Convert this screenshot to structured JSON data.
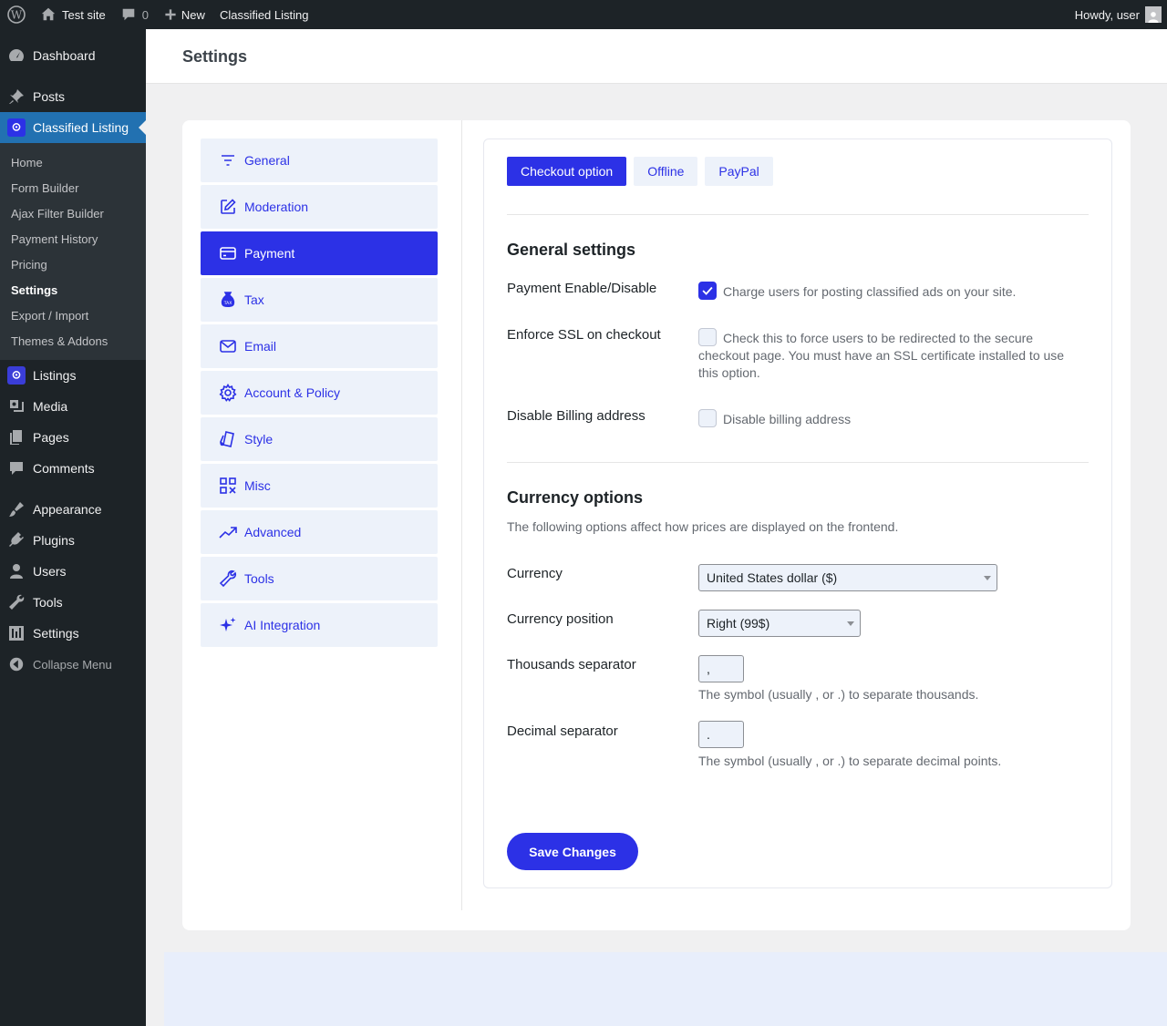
{
  "adminbar": {
    "site_name": "Test site",
    "comments_count": "0",
    "new_label": "New",
    "plugin_link": "Classified Listing",
    "howdy": "Howdy, user"
  },
  "sidebar": {
    "dashboard": "Dashboard",
    "posts": "Posts",
    "classified_listing": "Classified Listing",
    "submenu": [
      "Home",
      "Form Builder",
      "Ajax Filter Builder",
      "Payment History",
      "Pricing",
      "Settings",
      "Export / Import",
      "Themes & Addons"
    ],
    "listings": "Listings",
    "media": "Media",
    "pages": "Pages",
    "comments": "Comments",
    "appearance": "Appearance",
    "plugins": "Plugins",
    "users": "Users",
    "tools": "Tools",
    "settings": "Settings",
    "collapse": "Collapse Menu"
  },
  "page_title": "Settings",
  "settings_tabs": [
    "General",
    "Moderation",
    "Payment",
    "Tax",
    "Email",
    "Account & Policy",
    "Style",
    "Misc",
    "Advanced",
    "Tools",
    "AI Integration"
  ],
  "sub_tabs": [
    "Checkout option",
    "Offline",
    "PayPal"
  ],
  "general": {
    "title": "General settings",
    "payment_label": "Payment Enable/Disable",
    "payment_desc": "Charge users for posting classified ads on your site.",
    "ssl_label": "Enforce SSL on checkout",
    "ssl_desc": "Check this to force users to be redirected to the secure checkout page. You must have an SSL certificate installed to use this option.",
    "billing_label": "Disable Billing address",
    "billing_desc": "Disable billing address"
  },
  "currency": {
    "title": "Currency options",
    "desc": "The following options affect how prices are displayed on the frontend.",
    "currency_label": "Currency",
    "currency_value": "United States dollar ($)",
    "position_label": "Currency position",
    "position_value": "Right (99$)",
    "thousands_label": "Thousands separator",
    "thousands_value": ",",
    "thousands_desc": "The symbol (usually , or .) to separate thousands.",
    "decimal_label": "Decimal separator",
    "decimal_value": ".",
    "decimal_desc": "The symbol (usually , or .) to separate decimal points."
  },
  "save_label": "Save Changes",
  "colors": {
    "accent": "#2c31e6",
    "admin_dark": "#1d2327",
    "wp_blue": "#2271b1"
  }
}
